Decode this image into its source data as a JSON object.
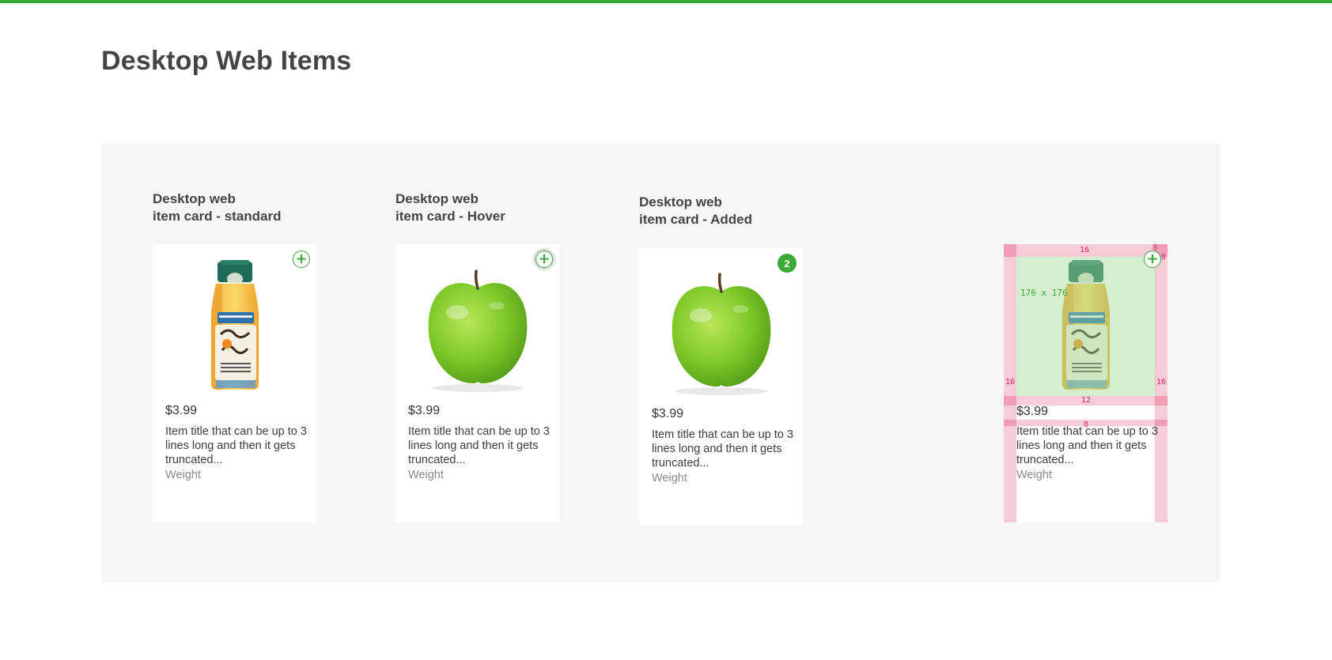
{
  "page": {
    "title": "Desktop Web Items"
  },
  "colors": {
    "accent": "#3aaa35",
    "panel_bg": "#f6f6f6",
    "spec_pink": "#f08caa",
    "spec_green": "#a0dc96"
  },
  "sections": [
    {
      "line1": "Desktop web",
      "line2": "item card - standard"
    },
    {
      "line1": "Desktop web",
      "line2": "item card - Hover"
    },
    {
      "line1": "Desktop web",
      "line2": "item card - Added"
    }
  ],
  "cards": [
    {
      "image": "orange-juice-bottle",
      "button_icon": "plus-icon",
      "button_glyph": "+",
      "price": "$3.99",
      "title": "Item title that can be up to 3 lines long and then it gets truncated...",
      "weight": "Weight"
    },
    {
      "image": "green-apple",
      "button_icon": "plus-icon",
      "button_glyph": "+",
      "price": "$3.99",
      "title": "Item title that can be up to 3 lines long and then it gets truncated...",
      "weight": "Weight"
    },
    {
      "image": "green-apple",
      "badge_count": "2",
      "price": "$3.99",
      "title": "Item title that can be up to 3 lines long and then it gets truncated...",
      "weight": "Weight"
    },
    {
      "image": "orange-juice-bottle",
      "button_icon": "plus-icon",
      "button_glyph": "+",
      "price": "$3.99",
      "title": "Item title that can be up to 3 lines long and then it gets truncated...",
      "weight": "Weight"
    }
  ],
  "spec": {
    "image_size": "176 x 176",
    "top_padding": "16",
    "button_offset_top": "8",
    "button_offset_right": "8",
    "left_padding": "16",
    "right_padding": "16",
    "image_price_gap": "12",
    "price_title_gap": "8"
  }
}
